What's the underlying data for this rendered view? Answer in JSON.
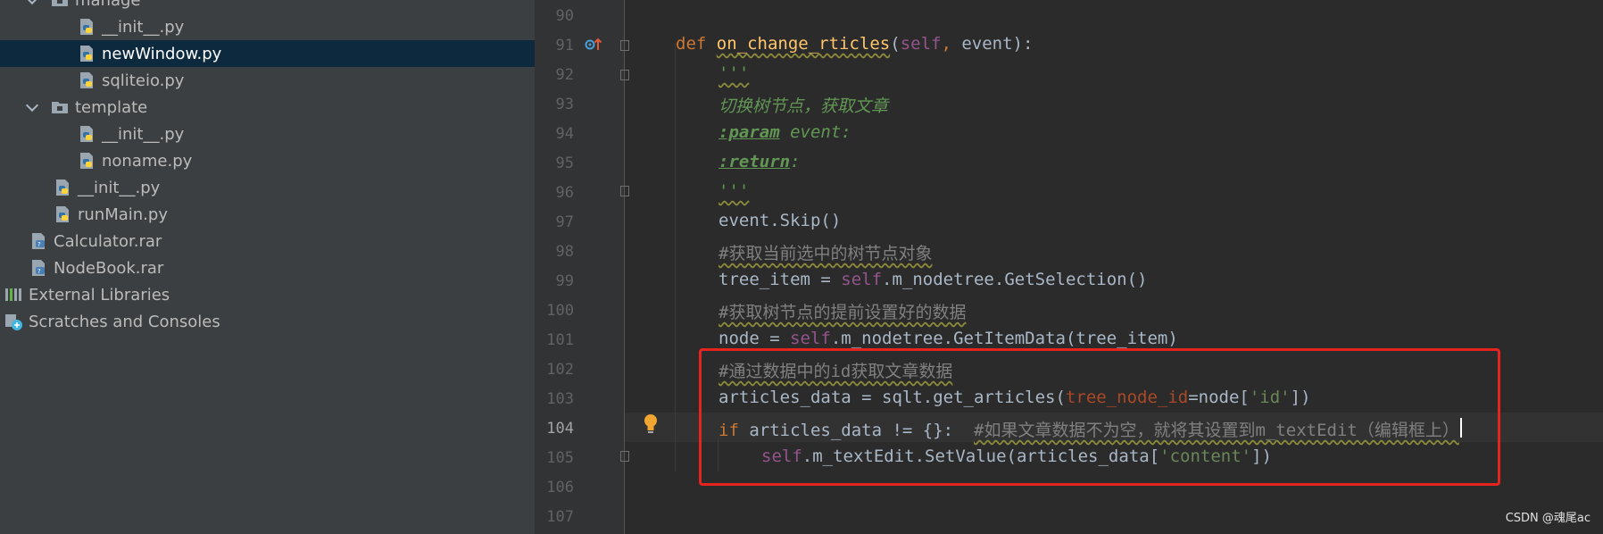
{
  "project_tree": {
    "items": [
      {
        "label": "manage",
        "kind": "folder",
        "expanded": true,
        "selected": false
      },
      {
        "label": "__init__.py",
        "kind": "python",
        "selected": false
      },
      {
        "label": "newWindow.py",
        "kind": "python",
        "selected": true
      },
      {
        "label": "sqliteio.py",
        "kind": "python",
        "selected": false
      },
      {
        "label": "template",
        "kind": "folder",
        "expanded": true,
        "selected": false
      },
      {
        "label": "__init__.py",
        "kind": "python",
        "selected": false
      },
      {
        "label": "noname.py",
        "kind": "python",
        "selected": false
      },
      {
        "label": "__init__.py",
        "kind": "python",
        "selected": false
      },
      {
        "label": "runMain.py",
        "kind": "python",
        "selected": false
      },
      {
        "label": "Calculator.rar",
        "kind": "archive",
        "selected": false
      },
      {
        "label": "NodeBook.rar",
        "kind": "archive",
        "selected": false
      },
      {
        "label": "External Libraries",
        "kind": "libraries",
        "selected": false
      },
      {
        "label": "Scratches and Consoles",
        "kind": "scratches",
        "selected": false
      }
    ]
  },
  "editor": {
    "current_line": "104",
    "lines": [
      {
        "n": "90",
        "tokens": []
      },
      {
        "n": "91",
        "tokens": [
          [
            "kw",
            "def "
          ],
          [
            "fn squig",
            "on_change_rticles"
          ],
          [
            "",
            "("
          ],
          [
            "self",
            "self"
          ],
          [
            "kw",
            ", "
          ],
          [
            "",
            "event):"
          ]
        ]
      },
      {
        "n": "92",
        "tokens": [
          [
            "doc squig",
            "'''"
          ]
        ]
      },
      {
        "n": "93",
        "tokens": [
          [
            "doc",
            "切换树节点，获取文章"
          ]
        ]
      },
      {
        "n": "94",
        "tokens": [
          [
            "doctag",
            ":param"
          ],
          [
            "doc",
            " event:"
          ]
        ]
      },
      {
        "n": "95",
        "tokens": [
          [
            "doctag",
            ":return"
          ],
          [
            "doc",
            ":"
          ]
        ]
      },
      {
        "n": "96",
        "tokens": [
          [
            "doc squig",
            "'''"
          ]
        ]
      },
      {
        "n": "97",
        "tokens": [
          [
            "",
            "event.Skip()"
          ]
        ]
      },
      {
        "n": "98",
        "tokens": [
          [
            "cmt squig",
            "#获取当前选中的树节点对象"
          ]
        ]
      },
      {
        "n": "99",
        "tokens": [
          [
            "",
            "tree_item = "
          ],
          [
            "self",
            "self"
          ],
          [
            "",
            ".m_nodetree.GetSelection()"
          ]
        ]
      },
      {
        "n": "100",
        "tokens": [
          [
            "cmt squig",
            "#获取树节点的提前设置好的数据"
          ]
        ]
      },
      {
        "n": "101",
        "tokens": [
          [
            "",
            "node = "
          ],
          [
            "self",
            "self"
          ],
          [
            "",
            ".m_nodetree.GetItemData(tree_item)"
          ]
        ]
      },
      {
        "n": "102",
        "tokens": [
          [
            "cmt squig",
            "#通过数据中的id获取文章数据"
          ]
        ]
      },
      {
        "n": "103",
        "tokens": [
          [
            "",
            "articles_data = sqlt.get_articles("
          ],
          [
            "param",
            "tree_node_id"
          ],
          [
            "",
            "=node["
          ],
          [
            "str",
            "'id'"
          ],
          [
            "",
            "])"
          ]
        ]
      },
      {
        "n": "104",
        "tokens": [
          [
            "kw",
            "if "
          ],
          [
            "",
            "articles_data != {}:  "
          ],
          [
            "cmt squig",
            "#如果文章数据不为空，就将其设置到m_textEdit（编辑框上）"
          ]
        ]
      },
      {
        "n": "105",
        "tokens": [
          [
            "self",
            "self"
          ],
          [
            "",
            ".m_textEdit.SetValue(articles_data["
          ],
          [
            "str",
            "'content'"
          ],
          [
            "",
            "])"
          ]
        ]
      },
      {
        "n": "106",
        "tokens": []
      },
      {
        "n": "107",
        "tokens": []
      }
    ]
  },
  "watermark": "CSDN @魂尾ac",
  "colors": {
    "panel_bg": "#3c3f41",
    "selection_bg": "#0d293e",
    "editor_bg": "#2b2b2b",
    "keyword": "#cc7832",
    "function": "#ffc66d",
    "self": "#94558d",
    "string": "#6a8759",
    "comment": "#808080",
    "highlight_box": "#e5231f"
  },
  "icons": [
    "folder-icon",
    "python-file-icon",
    "archive-file-icon",
    "libraries-icon",
    "scratches-icon",
    "override-gutter-icon",
    "lightbulb-icon"
  ]
}
